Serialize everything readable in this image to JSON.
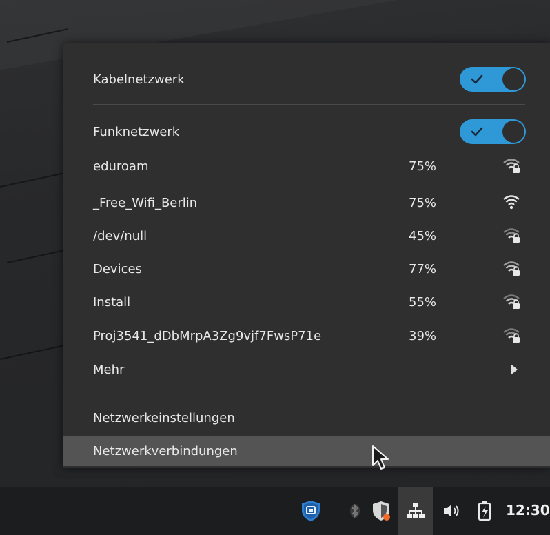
{
  "menu": {
    "wired": {
      "label": "Kabelnetzwerk",
      "enabled": true
    },
    "wireless": {
      "label": "Funknetzwerk",
      "enabled": true
    },
    "networks": [
      {
        "name": "eduroam",
        "signal": "75%",
        "secured": true
      },
      {
        "name": "_Free_Wifi_Berlin",
        "signal": "75%",
        "secured": false
      },
      {
        "name": "/dev/null",
        "signal": "45%",
        "secured": true
      },
      {
        "name": "Devices",
        "signal": "77%",
        "secured": true
      },
      {
        "name": "Install",
        "signal": "55%",
        "secured": true
      },
      {
        "name": "Proj3541_dDbMrpA3Zg9vjf7FwsP71e",
        "signal": "39%",
        "secured": true
      }
    ],
    "more_label": "Mehr",
    "settings_label": "Netzwerkeinstellungen",
    "connections_label": "Netzwerkverbindungen"
  },
  "panel": {
    "tray_icons": [
      "shield-app-icon",
      "bluetooth-icon",
      "security-alert-icon",
      "network-wired-icon",
      "volume-icon",
      "battery-charging-icon"
    ],
    "clock": "12:30"
  },
  "colors": {
    "accent": "#2f99d8",
    "menu_bg": "#2f2f2f",
    "hover_bg": "#545454",
    "panel_bg": "#1c1d1e"
  }
}
